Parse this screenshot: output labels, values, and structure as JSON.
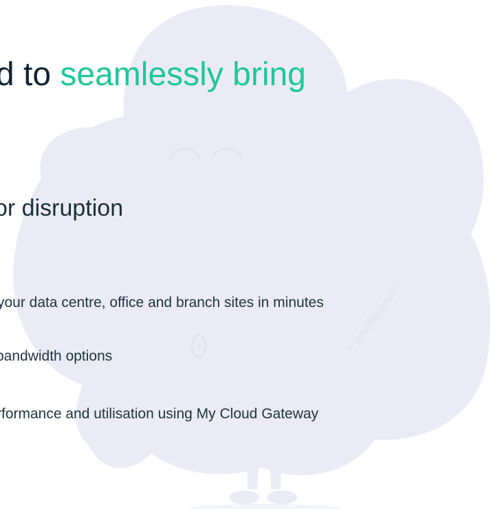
{
  "hero": {
    "headline_prefix": "d to ",
    "headline_accent": "seamlessly bring",
    "subheading": "or disruption"
  },
  "features": [
    "your data centre, office and branch sites in minutes",
    "bandwidth options",
    "rformance and utilisation using My Cloud Gateway"
  ],
  "colors": {
    "accent": "#1ec79a",
    "heading": "#0f2433",
    "body_text": "#1e3340",
    "cloud_fill": "#eaebf5"
  },
  "illustration": {
    "icon": "cloud-character-illustration"
  }
}
